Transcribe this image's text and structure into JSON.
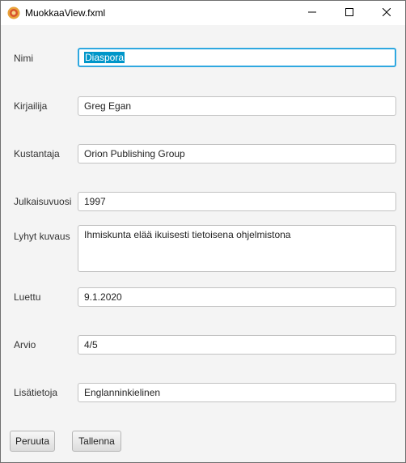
{
  "window": {
    "title": "MuokkaaView.fxml",
    "icon": "java-cup-icon",
    "controls": [
      "minimize-icon",
      "maximize-icon",
      "close-icon"
    ]
  },
  "form": {
    "nimi": {
      "label": "Nimi",
      "value": "Diaspora"
    },
    "kirjailija": {
      "label": "Kirjailija",
      "value": "Greg Egan"
    },
    "kustantaja": {
      "label": "Kustantaja",
      "value": "Orion Publishing Group"
    },
    "julkaisuvuosi": {
      "label": "Julkaisuvuosi",
      "value": "1997"
    },
    "kuvaus": {
      "label": "Lyhyt kuvaus",
      "value": "Ihmiskunta elää ikuisesti tietoisena ohjelmistona"
    },
    "luettu": {
      "label": "Luettu",
      "value": "9.1.2020"
    },
    "arvio": {
      "label": "Arvio",
      "value": "4/5"
    },
    "lisatietoja": {
      "label": "Lisätietoja",
      "value": "Englanninkielinen"
    }
  },
  "buttons": {
    "cancel": "Peruuta",
    "save": "Tallenna"
  },
  "colors": {
    "focus": "#2fa8e0",
    "selection": "#0096c9",
    "background": "#f4f4f4"
  }
}
